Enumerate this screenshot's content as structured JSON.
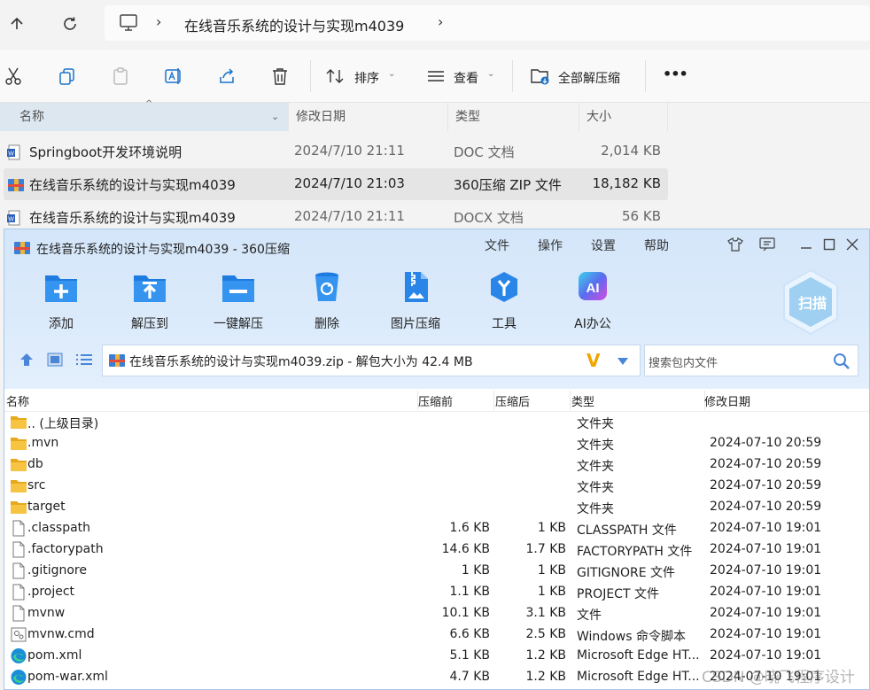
{
  "explorer": {
    "breadcrumb": "在线音乐系统的设计与实现m4039",
    "toolbar": {
      "sort_label": "排序",
      "view_label": "查看",
      "extract_all_label": "全部解压缩",
      "more_label": "•••"
    },
    "columns": {
      "name": "名称",
      "modified": "修改日期",
      "type": "类型",
      "size": "大小"
    },
    "files": [
      {
        "name": "Springboot开发环境说明",
        "modified": "2024/7/10 21:11",
        "type": "DOC 文档",
        "size": "2,014 KB",
        "icon": "word-doc-icon"
      },
      {
        "name": "在线音乐系统的设计与实现m4039",
        "modified": "2024/7/10 21:03",
        "type": "360压缩 ZIP 文件",
        "size": "18,182 KB",
        "icon": "zip-archive-icon"
      },
      {
        "name": "在线音乐系统的设计与实现m4039",
        "modified": "2024/7/10 21:11",
        "type": "DOCX 文档",
        "size": "56 KB",
        "icon": "word-docx-icon"
      }
    ]
  },
  "zip": {
    "title": "在线音乐系统的设计与实现m4039 - 360压缩",
    "menu": [
      "文件",
      "操作",
      "设置",
      "帮助"
    ],
    "buttons": [
      {
        "label": "添加",
        "icon": "add-icon"
      },
      {
        "label": "解压到",
        "icon": "extract-to-icon"
      },
      {
        "label": "一键解压",
        "icon": "one-click-extract-icon"
      },
      {
        "label": "删除",
        "icon": "recycle-delete-icon"
      },
      {
        "label": "图片压缩",
        "icon": "image-compress-icon"
      },
      {
        "label": "工具",
        "icon": "tools-icon"
      },
      {
        "label": "AI办公",
        "icon": "ai-office-icon"
      }
    ],
    "scan_label": "扫描",
    "path": "在线音乐系统的设计与实现m4039.zip - 解包大小为 42.4 MB",
    "search_placeholder": "搜索包内文件",
    "columns": {
      "name": "名称",
      "before": "压缩前",
      "after": "压缩后",
      "type": "类型",
      "modified": "修改日期"
    },
    "rows": [
      {
        "name": ".. (上级目录)",
        "before": "",
        "after": "",
        "type": "文件夹",
        "modified": "",
        "icon": "folder-icon"
      },
      {
        "name": ".mvn",
        "before": "",
        "after": "",
        "type": "文件夹",
        "modified": "2024-07-10 20:59",
        "icon": "folder-icon"
      },
      {
        "name": "db",
        "before": "",
        "after": "",
        "type": "文件夹",
        "modified": "2024-07-10 20:59",
        "icon": "folder-icon"
      },
      {
        "name": "src",
        "before": "",
        "after": "",
        "type": "文件夹",
        "modified": "2024-07-10 20:59",
        "icon": "folder-icon"
      },
      {
        "name": "target",
        "before": "",
        "after": "",
        "type": "文件夹",
        "modified": "2024-07-10 20:59",
        "icon": "folder-icon"
      },
      {
        "name": ".classpath",
        "before": "1.6 KB",
        "after": "1 KB",
        "type": "CLASSPATH 文件",
        "modified": "2024-07-10 19:01",
        "icon": "file-icon"
      },
      {
        "name": ".factorypath",
        "before": "14.6 KB",
        "after": "1.7 KB",
        "type": "FACTORYPATH 文件",
        "modified": "2024-07-10 19:01",
        "icon": "file-icon"
      },
      {
        "name": ".gitignore",
        "before": "1 KB",
        "after": "1 KB",
        "type": "GITIGNORE 文件",
        "modified": "2024-07-10 19:01",
        "icon": "file-icon"
      },
      {
        "name": ".project",
        "before": "1.1 KB",
        "after": "1 KB",
        "type": "PROJECT 文件",
        "modified": "2024-07-10 19:01",
        "icon": "file-icon"
      },
      {
        "name": "mvnw",
        "before": "10.1 KB",
        "after": "3.1 KB",
        "type": "文件",
        "modified": "2024-07-10 19:01",
        "icon": "file-icon"
      },
      {
        "name": "mvnw.cmd",
        "before": "6.6 KB",
        "after": "2.5 KB",
        "type": "Windows 命令脚本",
        "modified": "2024-07-10 19:01",
        "icon": "cmd-script-icon"
      },
      {
        "name": "pom.xml",
        "before": "5.1 KB",
        "after": "1.2 KB",
        "type": "Microsoft Edge HT...",
        "modified": "2024-07-10 19:01",
        "icon": "edge-icon"
      },
      {
        "name": "pom-war.xml",
        "before": "4.7 KB",
        "after": "1.2 KB",
        "type": "Microsoft Edge HT...",
        "modified": "2024-07-10 19:01",
        "icon": "edge-icon"
      }
    ]
  },
  "watermark": "CSDN @晓飞程序设计"
}
